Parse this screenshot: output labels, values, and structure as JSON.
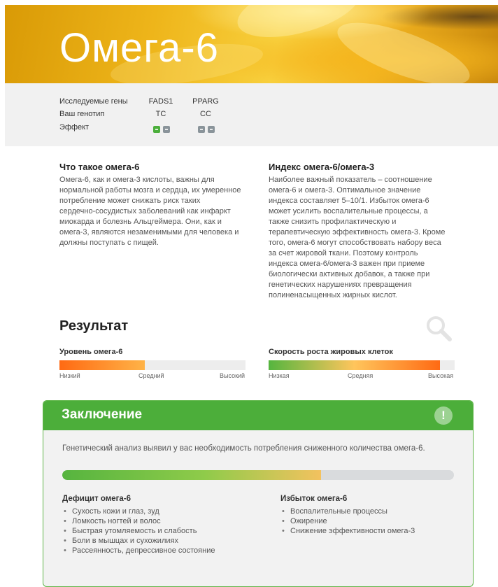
{
  "hero": {
    "title": "Омега-6"
  },
  "genes": {
    "row_labels": [
      "Исследуемые гены",
      "Ваш генотип",
      "Эффект"
    ],
    "columns": [
      {
        "gene": "FADS1",
        "genotype": "TC",
        "effect": [
          "green",
          "gray"
        ]
      },
      {
        "gene": "PPARG",
        "genotype": "CC",
        "effect": [
          "gray",
          "gray"
        ]
      }
    ]
  },
  "info": {
    "left": {
      "title": "Что такое омега-6",
      "lines": [
        "Омега-6, как и омега-3 кислоты, важны для",
        "нормальной работы мозга и сердца, их умеренное",
        "потребление может снижать риск таких",
        "сердечно-сосудистых заболеваний как инфаркт",
        "миокарда и болезнь Альцгеймера. Они, как и",
        "омега-3, являются незаменимыми для человека и",
        "должны поступать с пищей."
      ]
    },
    "right": {
      "title": "Индекс омега-6/омега-3",
      "lines": [
        "Наиболее важный показатель – соотношение",
        "омега-6 и омега-3. Оптимальное значение",
        "индекса составляет 5–10/1. Избыток омега-6",
        "может усилить воспалительные процессы, а",
        "также снизить профилактическую и",
        "терапевтическую эффективность омега-3. Кроме",
        "того, омега-6 могут способствовать набору веса",
        "за счет жировой ткани. Поэтому контроль",
        "индекса омега-6/омега-3 важен при приеме",
        "биологически активных добавок, а также при",
        "генетических нарушениях превращения",
        "полиненасыщенных жирных кислот."
      ]
    }
  },
  "result": {
    "title": "Результат",
    "icon": "magnifier-icon",
    "bars": [
      {
        "label": "Уровень омега-6",
        "fill_fraction": 0.46,
        "ticks": [
          "Низкий",
          "Средний",
          "Высокий"
        ],
        "colors": [
          "#ff6a13",
          "#ffb347"
        ]
      },
      {
        "label": "Скорость роста жировых клеток",
        "fill_fraction": 0.92,
        "ticks": [
          "Низкая",
          "Средняя",
          "Высокая"
        ],
        "colors": [
          "#55b53f",
          "#ffc55c",
          "#ff6a13"
        ]
      }
    ]
  },
  "conclusion": {
    "title": "Заключение",
    "icon": "exclamation-icon",
    "icon_glyph": "!",
    "text": "Генетический анализ выявил у вас необходимость потребления сниженного количества омега-6.",
    "bar_fill_fraction": 0.66,
    "left": {
      "title": "Дефицит омега-6",
      "items": [
        "Сухость кожи и глаз, зуд",
        "Ломкость ногтей и волос",
        "Быстрая утомляемость и слабость",
        "Боли в мышцах и сухожилиях",
        "Рассеянность, депрессивное состояние"
      ]
    },
    "right": {
      "title": "Избыток омега-6",
      "items": [
        "Воспалительные процессы",
        "Ожирение",
        "Снижение эффективности омега-3"
      ]
    }
  }
}
